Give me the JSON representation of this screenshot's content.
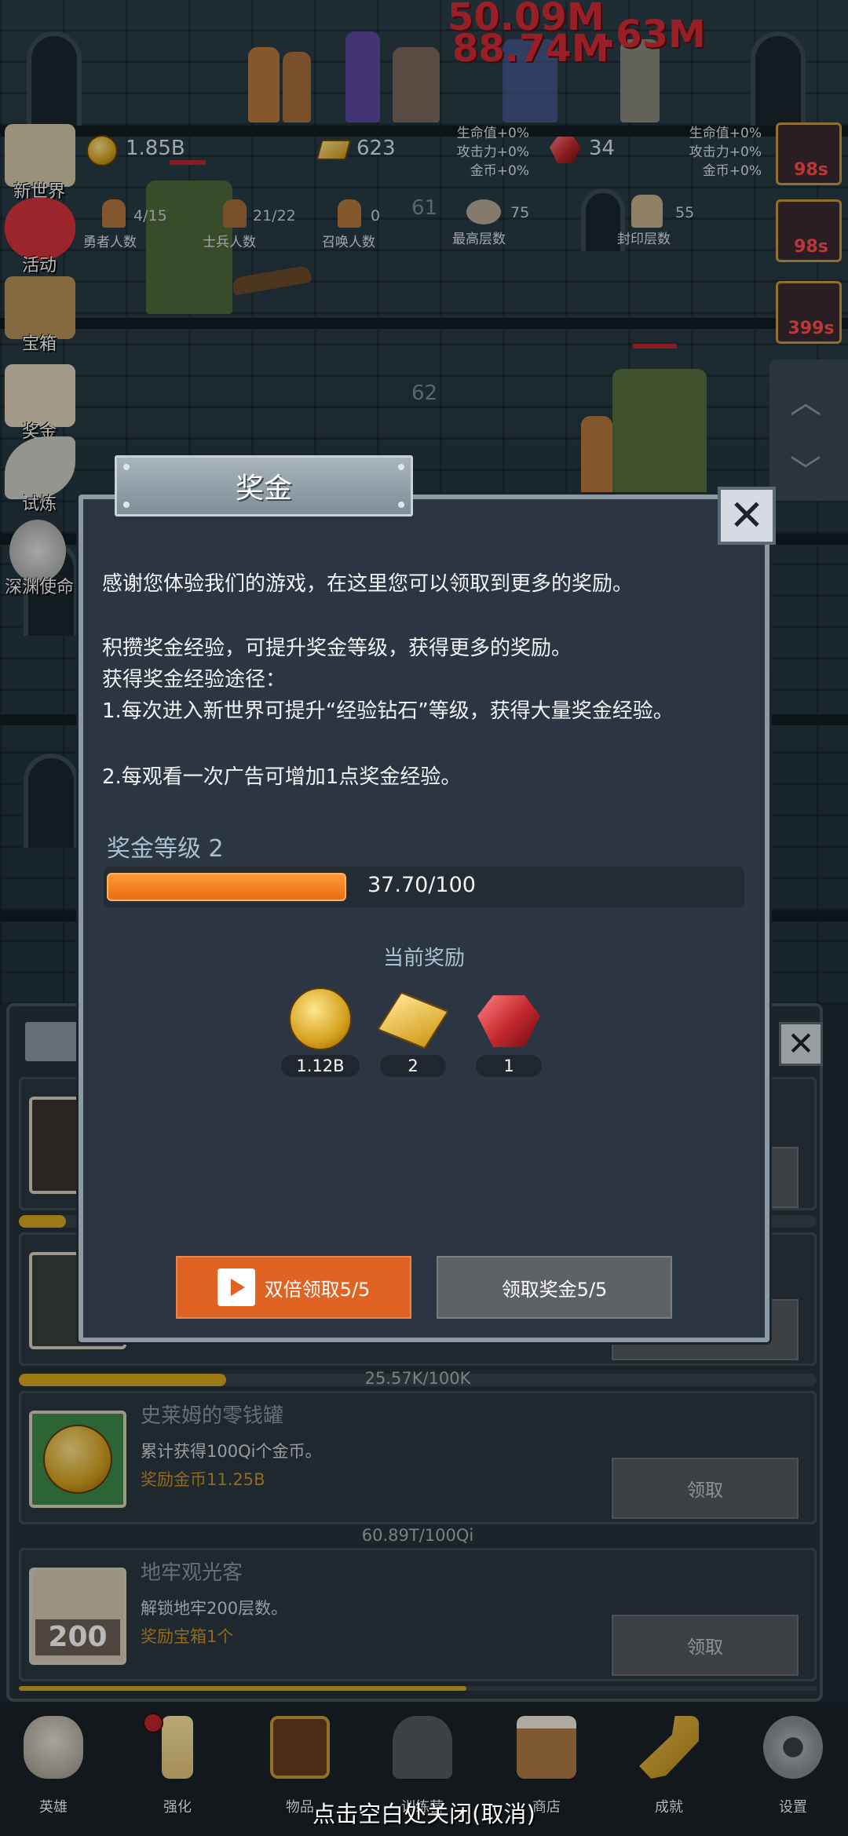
{
  "hud": {
    "damage_1": "50.09M",
    "damage_2": "88.74M",
    "damage_3": ".63M",
    "gold": "1.85B",
    "gold_bars": "623",
    "gems": "34",
    "buff_hp": "生命值+0%",
    "buff_atk": "攻击力+0%",
    "buff_gold": "金币+0%",
    "heroes_value": "4/15",
    "heroes_label": "勇者人数",
    "soldiers_value": "21/22",
    "soldiers_label": "士兵人数",
    "summon_value": "0",
    "summon_label": "召唤人数",
    "max_floor_value": "75",
    "max_floor_label": "最高层数",
    "seal_floor_value": "55",
    "seal_floor_label": "封印层数",
    "floor_a": "61",
    "floor_b": "62"
  },
  "side_menu": [
    {
      "label": "新世界",
      "icon": "map-icon"
    },
    {
      "label": "活动",
      "icon": "heart-icon"
    },
    {
      "label": "宝箱",
      "icon": "chest-icon"
    },
    {
      "label": "奖金",
      "icon": "envelope-icon"
    },
    {
      "label": "试炼",
      "icon": "feather-icon"
    },
    {
      "label": "深渊使命",
      "icon": "orb-icon"
    }
  ],
  "timers": [
    "98s",
    "98s",
    "399s"
  ],
  "achievements": [
    {
      "title": "",
      "desc": "",
      "reward": "",
      "button": ""
    },
    {
      "title": "",
      "desc": "",
      "reward": "",
      "button": ""
    },
    {
      "title": "史莱姆的零钱罐",
      "desc": "累计获得100Qi个金币。",
      "reward": "奖励金币11.25B",
      "button": "领取",
      "progress_text": "25.57K/100K",
      "progress": 0.26
    },
    {
      "title": "地牢观光客",
      "desc": "解锁地牢200层数。",
      "reward": "奖励宝箱1个",
      "button": "领取",
      "progress_text": "60.89T/100Qi",
      "progress": 0.01
    }
  ],
  "bottom_nav": [
    {
      "label": "英雄",
      "icon": "skull-icon"
    },
    {
      "label": "强化",
      "icon": "candle-icon"
    },
    {
      "label": "物品",
      "icon": "book-icon"
    },
    {
      "label": "训练营",
      "icon": "lantern-icon"
    },
    {
      "label": "商店",
      "icon": "mug-icon"
    },
    {
      "label": "成就",
      "icon": "key-icon"
    },
    {
      "label": "设置",
      "icon": "gear-icon"
    }
  ],
  "close_hint": "点击空白处关闭(取消)",
  "modal": {
    "title": "奖金",
    "line1": "感谢您体验我们的游戏，在这里您可以领取到更多的奖励。",
    "line2": "积攒奖金经验，可提升奖金等级，获得更多的奖励。",
    "line3": "获得奖金经验途径：",
    "line4": "1.每次进入新世界可提升“经验钻石”等级，获得大量奖金经验。",
    "line5": "2.每观看一次广告可增加1点奖金经验。",
    "level_label": "奖金等级 2",
    "level_progress_text": "37.70/100",
    "level_progress": 0.377,
    "reward_title": "当前奖励",
    "rewards": [
      {
        "type": "gold-coin",
        "amount": "1.12B"
      },
      {
        "type": "gold-bar",
        "amount": "2"
      },
      {
        "type": "ruby",
        "amount": "1"
      }
    ],
    "double_button": "双倍领取5/5",
    "claim_button": "领取奖金5/5"
  },
  "colors": {
    "accent_orange": "#e06324",
    "progress_orange": "#ff9a3a",
    "reward_gold": "#c8932c",
    "damage_red": "#d32c35"
  }
}
